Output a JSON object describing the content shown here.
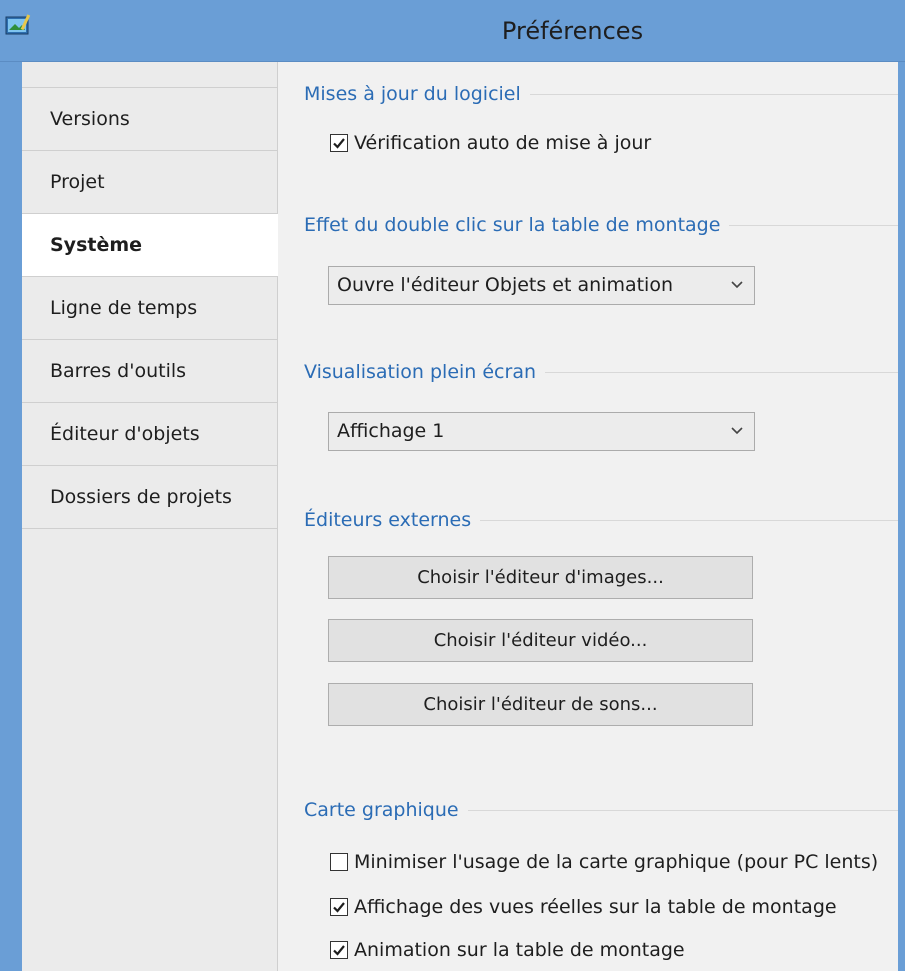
{
  "window": {
    "title": "Préférences"
  },
  "sidebar": {
    "items": [
      {
        "label": "Versions"
      },
      {
        "label": "Projet"
      },
      {
        "label": "Système"
      },
      {
        "label": "Ligne de temps"
      },
      {
        "label": "Barres d'outils"
      },
      {
        "label": "Éditeur d'objets"
      },
      {
        "label": "Dossiers de projets"
      }
    ],
    "active": "Système"
  },
  "sections": {
    "updates": {
      "title": "Mises à jour du logiciel",
      "auto_check": {
        "label": "Vérification auto de mise à jour",
        "checked": true
      }
    },
    "double_click": {
      "title": "Effet du double clic sur la table de montage",
      "selected": "Ouvre l'éditeur Objets et animation"
    },
    "fullscreen": {
      "title": "Visualisation plein écran",
      "selected": "Affichage 1"
    },
    "external_editors": {
      "title": "Éditeurs externes",
      "image_button": "Choisir l'éditeur d'images...",
      "video_button": "Choisir l'éditeur vidéo...",
      "sound_button": "Choisir l'éditeur de sons..."
    },
    "graphics": {
      "title": "Carte graphique",
      "minimize": {
        "label": "Minimiser l'usage de la carte graphique (pour PC lents)",
        "checked": false
      },
      "real_views": {
        "label": "Affichage des vues réelles sur la table de montage",
        "checked": true
      },
      "animation": {
        "label": "Animation sur la table de montage",
        "checked": true
      }
    }
  },
  "colors": {
    "titlebar": "#6a9ed6",
    "section_heading": "#2b6cb5"
  }
}
